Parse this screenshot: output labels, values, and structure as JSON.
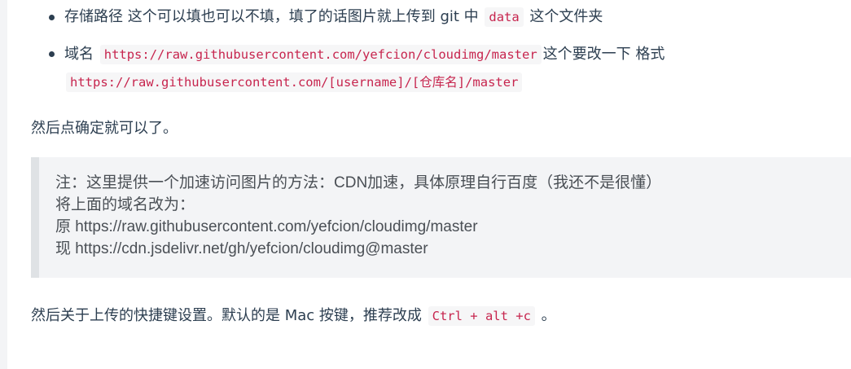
{
  "list": {
    "item1": {
      "text_before": "存储路径 这个可以填也可以不填，填了的话图片就上传到 git 中 ",
      "code": "data",
      "text_after": " 这个文件夹"
    },
    "item2": {
      "text_before": "域名 ",
      "code1": "https://raw.githubusercontent.com/yefcion/cloudimg/master",
      "text_middle": "这个要改一下 格式",
      "code2": "https://raw.githubusercontent.com/[username]/[仓库名]/master"
    }
  },
  "paragraph1": "然后点确定就可以了。",
  "note": {
    "line1": "注：这里提供一个加速访问图片的方法：CDN加速，具体原理自行百度（我还不是很懂）",
    "line2": "将上面的域名改为：",
    "line3": "原 https://raw.githubusercontent.com/yefcion/cloudimg/master",
    "line4": "现 https://cdn.jsdelivr.net/gh/yefcion/cloudimg@master"
  },
  "paragraph2": {
    "text_before": "然后关于上传的快捷键设置。默认的是 Mac 按键，推荐改成 ",
    "code": "Ctrl + alt +c",
    "text_after": " 。"
  },
  "colors": {
    "code_text": "#c7254e",
    "code_bg": "#f6f6f7",
    "note_bg": "#f3f4f6",
    "note_border": "#dfe2e5",
    "body_text": "#2c3e50"
  }
}
